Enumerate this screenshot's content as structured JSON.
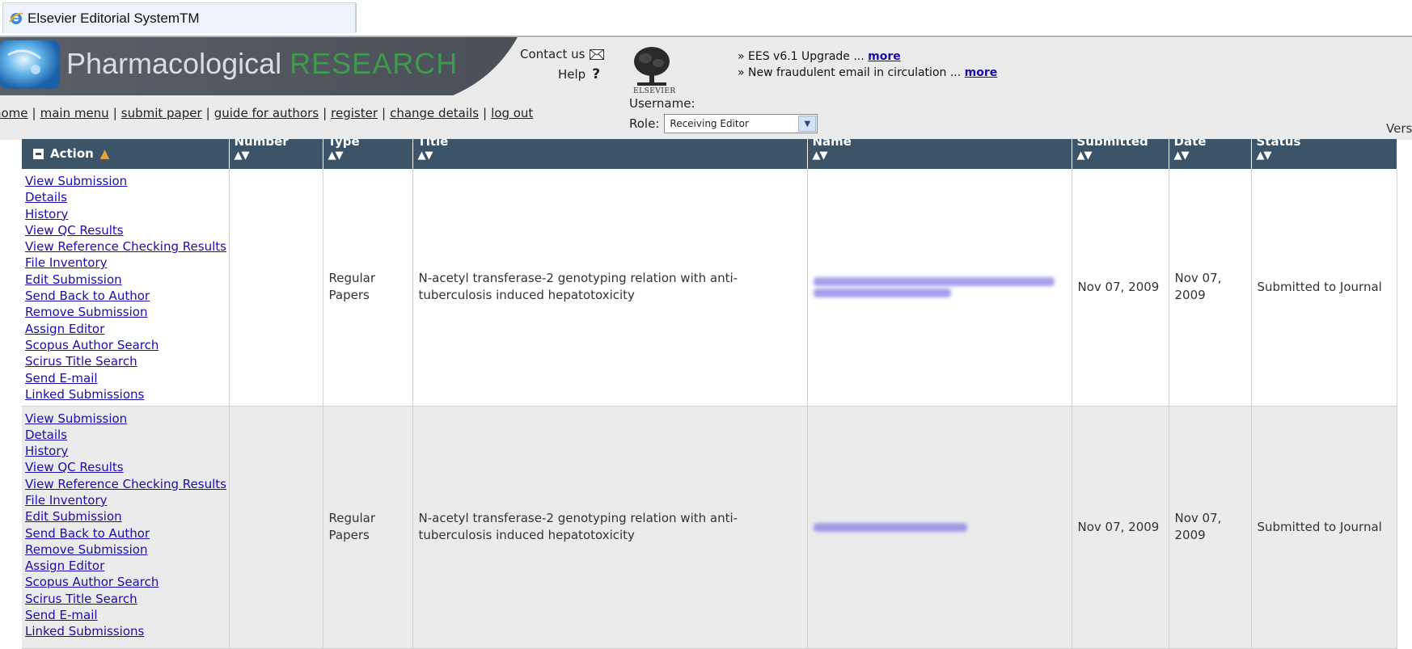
{
  "window": {
    "tab_title": "Elsevier Editorial SystemTM"
  },
  "header": {
    "journal_name_part1": "Pharmacological",
    "journal_name_part2": "RESEARCH",
    "contact_label": "Contact us",
    "help_label": "Help",
    "help_symbol": "?",
    "publisher_word": "ELSEVIER",
    "news": [
      {
        "text": "» EES v6.1 Upgrade ... ",
        "link": "more"
      },
      {
        "text": "» New fraudulent email in circulation ... ",
        "link": "more"
      }
    ],
    "nav": [
      "home",
      "main menu",
      "submit paper",
      "guide for authors",
      "register",
      "change details",
      "log out"
    ],
    "nav_separator": "|",
    "username_label": "Username:",
    "role_label": "Role:",
    "role_value": "Receiving Editor",
    "version_label": "Versio"
  },
  "table": {
    "columns": [
      {
        "label": "Action",
        "sort": ""
      },
      {
        "label": "Number",
        "sort": "▲▼"
      },
      {
        "label": "Type",
        "sort": "▲▼"
      },
      {
        "label": "Title",
        "sort": "▲▼"
      },
      {
        "label": "Name",
        "sort": "▲▼"
      },
      {
        "label": "Submitted",
        "sort": "▲▼"
      },
      {
        "label": "Date",
        "sort": "▲▼"
      },
      {
        "label": "Status",
        "sort": "▲▼"
      }
    ],
    "rows": [
      {
        "actions": [
          "View Submission",
          "Details",
          "History",
          "View QC Results",
          "View Reference Checking Results",
          "File Inventory",
          "Edit Submission",
          "Send Back to Author",
          "Remove Submission",
          "Assign Editor",
          "Scopus Author Search",
          "Scirus Title Search",
          "Send E-mail",
          "Linked Submissions"
        ],
        "number": "",
        "type": "Regular Papers",
        "title": "N-acetyl transferase-2 genotyping relation with anti-tuberculosis induced hepatotoxicity",
        "submitted": "Nov 07, 2009",
        "date": "Nov 07, 2009",
        "status": "Submitted to Journal"
      },
      {
        "actions": [
          "View Submission",
          "Details",
          "History",
          "View QC Results",
          "View Reference Checking Results",
          "File Inventory",
          "Edit Submission",
          "Send Back to Author",
          "Remove Submission",
          "Assign Editor",
          "Scopus Author Search",
          "Scirus Title Search",
          "Send E-mail",
          "Linked Submissions"
        ],
        "number": "",
        "type": "Regular Papers",
        "title": "N-acetyl transferase-2 genotyping relation with anti-tuberculosis induced hepatotoxicity",
        "submitted": "Nov 07, 2009",
        "date": "Nov 07, 2009",
        "status": "Submitted to Journal"
      }
    ]
  }
}
